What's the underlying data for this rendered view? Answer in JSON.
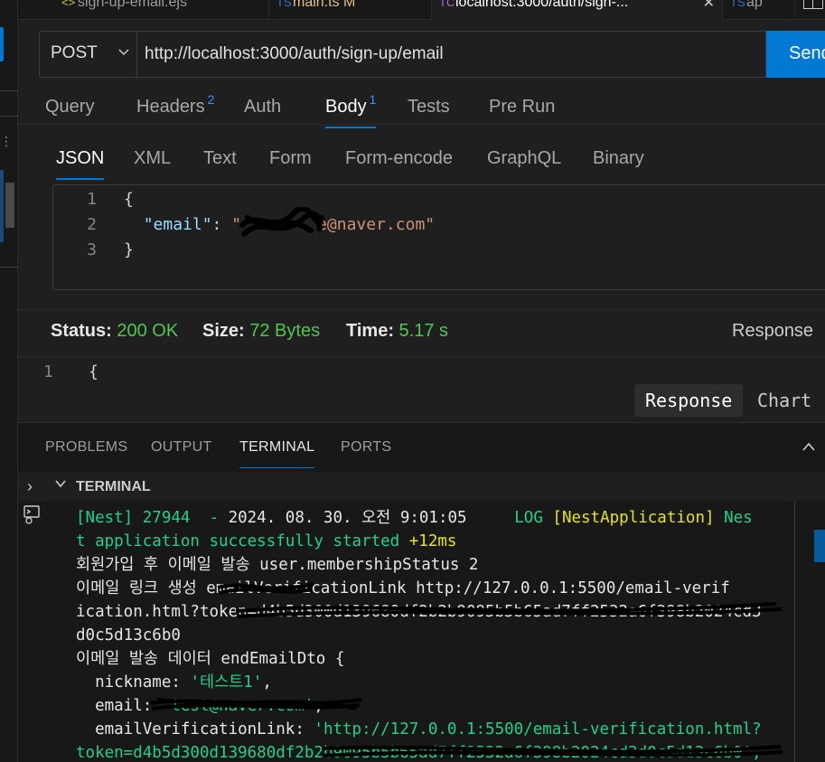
{
  "tabs": [
    {
      "label": "sign-up-email.ejs",
      "active": false
    },
    {
      "label": "main.ts  M",
      "active": false
    },
    {
      "label": "localhost:3000/auth/sign-...",
      "active": true
    },
    {
      "label": "ap",
      "active": false
    }
  ],
  "request": {
    "method": "POST",
    "url": "http://localhost:3000/auth/sign-up/email",
    "send_label": "Send"
  },
  "request_tabs": [
    {
      "label": "Query",
      "badge": ""
    },
    {
      "label": "Headers",
      "badge": "2"
    },
    {
      "label": "Auth",
      "badge": ""
    },
    {
      "label": "Body",
      "badge": "1",
      "active": true
    },
    {
      "label": "Tests",
      "badge": ""
    },
    {
      "label": "Pre Run",
      "badge": ""
    }
  ],
  "body_tabs": [
    "JSON",
    "XML",
    "Text",
    "Form",
    "Form-encode",
    "GraphQL",
    "Binary"
  ],
  "body_code": {
    "line_numbers": [
      "1",
      "2",
      "3"
    ],
    "line1": "{",
    "key": "\"email\"",
    "colon": ": ",
    "value_prefix": "\"",
    "value_suffix": "e@naver.com\"",
    "line3": "}"
  },
  "status": {
    "status_label": "Status:",
    "status_value": "200 OK",
    "size_label": "Size:",
    "size_value": "72 Bytes",
    "time_label": "Time:",
    "time_value": "5.17 s",
    "right_label": "Response"
  },
  "response": {
    "line_number": "1",
    "line": "{",
    "tab_response": "Response",
    "tab_chart": "Chart"
  },
  "panel_tabs": [
    "PROBLEMS",
    "OUTPUT",
    "TERMINAL",
    "PORTS"
  ],
  "terminal": {
    "header": "TERMINAL",
    "l1_a": "[Nest] 27944  - ",
    "l1_b": "2024. 08. 30. 오전 9:01:05",
    "l1_c": "     LOG ",
    "l1_d": "[NestApplication]",
    "l1_e": " Nes",
    "l2_a": "t application successfully started ",
    "l2_b": "+12ms",
    "l3": "회원가입 후 이메일 발송 user.membershipStatus 2",
    "l4": "이메일 링크 생성 emailVerificationLink http://127.0.0.1:5500/email-verif",
    "l5": "ication.html?token=d4b5d300d139680df2b2b9095b5b65ad7ff2532a6f398b2024cd3",
    "l6": "d0c5d13c6b0",
    "l7": "이메일 발송 데이터 endEmailDto {",
    "l8_a": "  nickname: ",
    "l8_b": "'테스트1'",
    "l8_c": ",",
    "l9_a": "  email: ",
    "l9_b": "'test@naver.com'",
    "l9_c": ",",
    "l10_a": "  emailVerificationLink: ",
    "l10_b": "'http://127.0.0.1:5500/email-verification.html?",
    "l11": "token=d4b5d300d139680df2b2b9095b5b65ad7ff2532a6f398b2024cd3d0c5d13c6b0',"
  }
}
